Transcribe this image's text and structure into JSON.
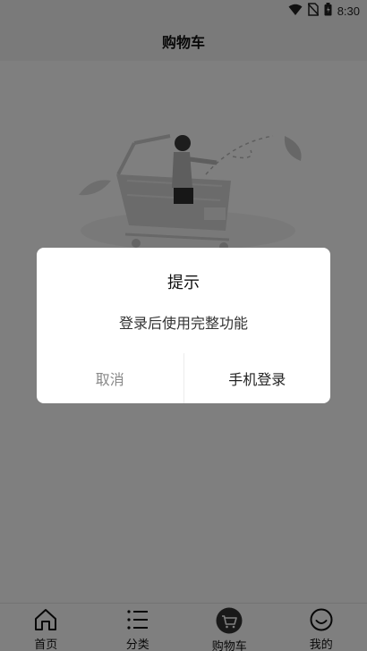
{
  "status_bar": {
    "time": "8:30",
    "icons": [
      "wifi-icon",
      "no-sim-icon",
      "battery-icon"
    ]
  },
  "header": {
    "title": "购物车"
  },
  "empty_state": {
    "illustration": "empty-cart-illustration"
  },
  "dialog": {
    "title": "提示",
    "message": "登录后使用完整功能",
    "cancel_label": "取消",
    "confirm_label": "手机登录"
  },
  "bottom_nav": {
    "items": [
      {
        "label": "首页",
        "icon": "home-icon"
      },
      {
        "label": "分类",
        "icon": "list-icon"
      },
      {
        "label": "购物车",
        "icon": "cart-icon"
      },
      {
        "label": "我的",
        "icon": "smiley-icon"
      }
    ]
  },
  "colors": {
    "overlay": "#000000",
    "nav_active": "#333333"
  }
}
